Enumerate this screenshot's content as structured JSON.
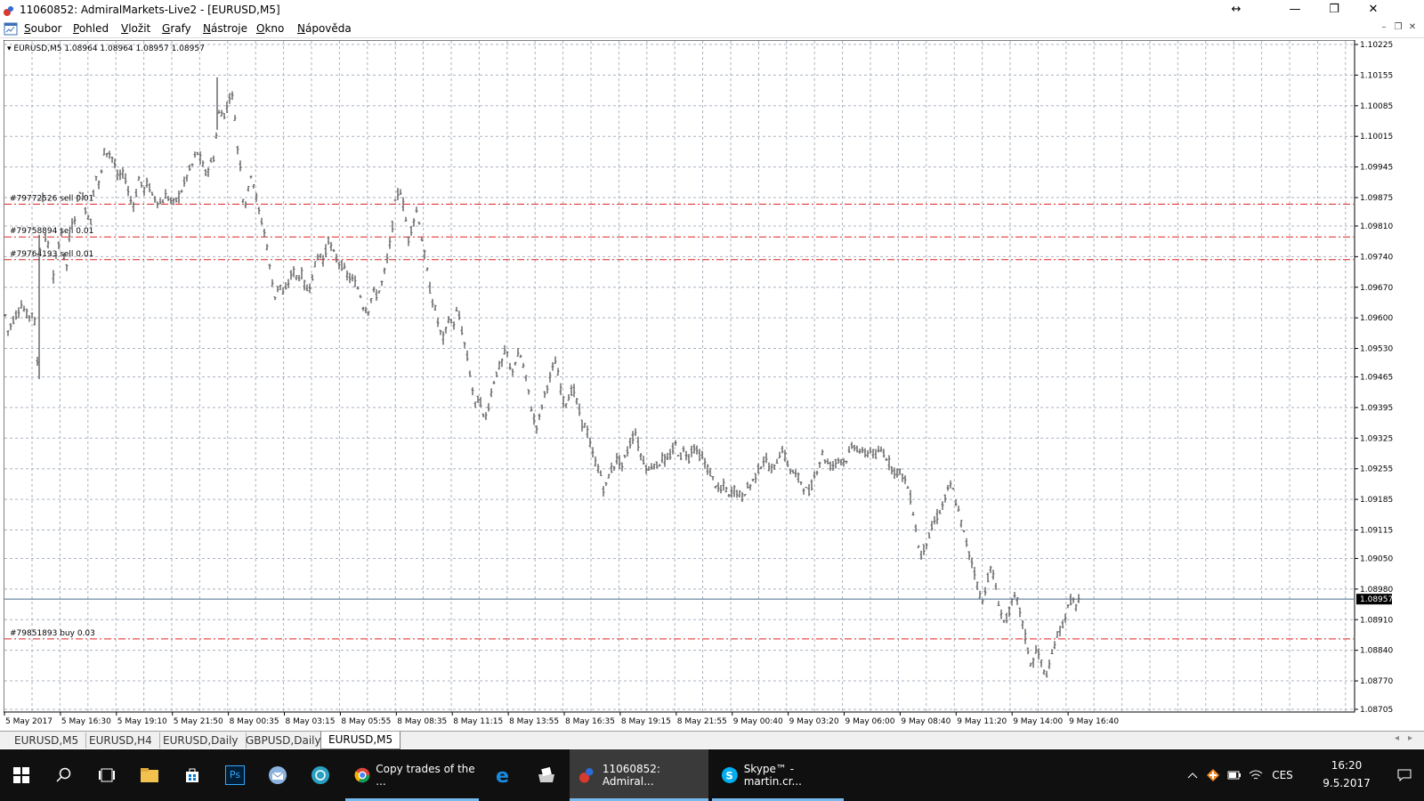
{
  "window": {
    "title": "11060852: AdmiralMarkets-Live2 - [EURUSD,M5]",
    "controls": {
      "resize_glyph": "↔",
      "minimize": "—",
      "maximize": "❐",
      "close": "✕"
    }
  },
  "menu": {
    "items": [
      "Soubor",
      "Pohled",
      "Vložit",
      "Grafy",
      "Nástroje",
      "Okno",
      "Nápověda"
    ],
    "mdi_controls": [
      "–",
      "❐",
      "✕"
    ]
  },
  "chart": {
    "header_label": "▾ EURUSD,M5  1.08964 1.08964 1.08957 1.08957",
    "current_price_label": "1.08957",
    "colors": {
      "candles": "#606060",
      "grid": "#a9b3c0",
      "order_line": "#e02020",
      "bid_line": "#4a6a8a"
    }
  },
  "chart_data": {
    "type": "candlestick",
    "symbol": "EURUSD",
    "timeframe": "M5",
    "ylim": [
      1.08705,
      1.10225
    ],
    "y_ticks": [
      "1.10225",
      "1.10155",
      "1.10085",
      "1.10015",
      "1.09945",
      "1.09875",
      "1.09810",
      "1.09740",
      "1.09670",
      "1.09600",
      "1.09530",
      "1.09465",
      "1.09395",
      "1.09325",
      "1.09255",
      "1.09185",
      "1.09115",
      "1.09050",
      "1.08980",
      "1.08910",
      "1.08840",
      "1.08770",
      "1.08705"
    ],
    "x_ticks": [
      "5 May 2017",
      "5 May 16:30",
      "5 May 19:10",
      "5 May 21:50",
      "8 May 00:35",
      "8 May 03:15",
      "8 May 05:55",
      "8 May 08:35",
      "8 May 11:15",
      "8 May 13:55",
      "8 May 16:35",
      "8 May 19:15",
      "8 May 21:55",
      "9 May 00:40",
      "9 May 03:20",
      "9 May 06:00",
      "9 May 08:40",
      "9 May 11:20",
      "9 May 14:00",
      "9 May 16:40"
    ],
    "price_path": [
      [
        0,
        1.0963
      ],
      [
        5,
        1.0957
      ],
      [
        12,
        1.096
      ],
      [
        20,
        1.0963
      ],
      [
        28,
        1.096
      ],
      [
        34,
        1.0962
      ],
      [
        38,
        1.095
      ],
      [
        40,
        1.0972
      ],
      [
        44,
        1.0988
      ],
      [
        48,
        1.0975
      ],
      [
        52,
        1.0978
      ],
      [
        55,
        1.0968
      ],
      [
        60,
        1.0975
      ],
      [
        65,
        1.098
      ],
      [
        70,
        1.097
      ],
      [
        75,
        1.098
      ],
      [
        80,
        1.0983
      ],
      [
        85,
        1.099
      ],
      [
        92,
        1.0985
      ],
      [
        98,
        1.0982
      ],
      [
        103,
        1.0993
      ],
      [
        108,
        1.099
      ],
      [
        113,
        1.0998
      ],
      [
        118,
        1.0998
      ],
      [
        124,
        1.0996
      ],
      [
        128,
        1.0992
      ],
      [
        133,
        1.0993
      ],
      [
        137,
        1.0992
      ],
      [
        142,
        1.0987
      ],
      [
        147,
        1.0986
      ],
      [
        152,
        1.0992
      ],
      [
        157,
        1.0989
      ],
      [
        162,
        1.0991
      ],
      [
        167,
        1.0988
      ],
      [
        172,
        1.0987
      ],
      [
        177,
        1.0986
      ],
      [
        182,
        1.0988
      ],
      [
        187,
        1.0987
      ],
      [
        192,
        1.0986
      ],
      [
        197,
        1.0988
      ],
      [
        202,
        1.099
      ],
      [
        207,
        1.0993
      ],
      [
        212,
        1.0995
      ],
      [
        217,
        1.0998
      ],
      [
        222,
        1.0996
      ],
      [
        227,
        1.0993
      ],
      [
        232,
        1.0995
      ],
      [
        237,
        1.0997
      ],
      [
        240,
        1.1004
      ],
      [
        243,
        1.1008
      ],
      [
        247,
        1.1006
      ],
      [
        251,
        1.1008
      ],
      [
        255,
        1.1012
      ],
      [
        259,
        1.1009
      ],
      [
        262,
        1.1
      ],
      [
        266,
        1.0995
      ],
      [
        270,
        1.0985
      ],
      [
        274,
        1.0988
      ],
      [
        278,
        1.0993
      ],
      [
        282,
        1.099
      ],
      [
        286,
        1.0985
      ],
      [
        290,
        1.0982
      ],
      [
        295,
        1.0978
      ],
      [
        300,
        1.097
      ],
      [
        305,
        1.0965
      ],
      [
        310,
        1.0968
      ],
      [
        315,
        1.0965
      ],
      [
        320,
        1.0968
      ],
      [
        325,
        1.0971
      ],
      [
        330,
        1.0969
      ],
      [
        335,
        1.097
      ],
      [
        340,
        1.0966
      ],
      [
        345,
        1.0968
      ],
      [
        350,
        1.0972
      ],
      [
        355,
        1.0975
      ],
      [
        360,
        1.0973
      ],
      [
        365,
        1.0978
      ],
      [
        370,
        1.0975
      ],
      [
        375,
        1.0973
      ],
      [
        380,
        1.0972
      ],
      [
        385,
        1.097
      ],
      [
        390,
        1.0969
      ],
      [
        395,
        1.0968
      ],
      [
        400,
        1.0966
      ],
      [
        405,
        1.0962
      ],
      [
        410,
        1.0962
      ],
      [
        415,
        1.0966
      ],
      [
        420,
        1.0965
      ],
      [
        425,
        1.0968
      ],
      [
        430,
        1.0972
      ],
      [
        435,
        1.0978
      ],
      [
        440,
        1.0986
      ],
      [
        445,
        1.099
      ],
      [
        450,
        1.0985
      ],
      [
        455,
        1.0978
      ],
      [
        460,
        1.0982
      ],
      [
        465,
        1.0985
      ],
      [
        470,
        1.0978
      ],
      [
        475,
        1.0972
      ],
      [
        480,
        1.0965
      ],
      [
        485,
        1.0962
      ],
      [
        490,
        1.0957
      ],
      [
        495,
        1.0955
      ],
      [
        500,
        1.096
      ],
      [
        505,
        1.0958
      ],
      [
        510,
        1.0962
      ],
      [
        515,
        1.0957
      ],
      [
        520,
        1.0952
      ],
      [
        525,
        1.0946
      ],
      [
        530,
        1.094
      ],
      [
        535,
        1.0942
      ],
      [
        540,
        1.0936
      ],
      [
        545,
        1.094
      ],
      [
        550,
        1.0945
      ],
      [
        555,
        1.0948
      ],
      [
        560,
        1.095
      ],
      [
        565,
        1.0953
      ],
      [
        570,
        1.0947
      ],
      [
        575,
        1.095
      ],
      [
        580,
        1.0952
      ],
      [
        585,
        1.0948
      ],
      [
        590,
        1.0943
      ],
      [
        595,
        1.0937
      ],
      [
        600,
        1.0935
      ],
      [
        605,
        1.094
      ],
      [
        610,
        1.0944
      ],
      [
        615,
        1.0947
      ],
      [
        620,
        1.095
      ],
      [
        625,
        1.0945
      ],
      [
        630,
        1.094
      ],
      [
        635,
        1.0942
      ],
      [
        640,
        1.0944
      ],
      [
        645,
        1.094
      ],
      [
        650,
        1.0936
      ],
      [
        655,
        1.0935
      ],
      [
        660,
        1.093
      ],
      [
        665,
        1.0927
      ],
      [
        670,
        1.0925
      ],
      [
        675,
        1.092
      ],
      [
        680,
        1.0924
      ],
      [
        685,
        1.0926
      ],
      [
        690,
        1.0928
      ],
      [
        695,
        1.0926
      ],
      [
        700,
        1.0929
      ],
      [
        705,
        1.0932
      ],
      [
        710,
        1.0934
      ],
      [
        715,
        1.0929
      ],
      [
        720,
        1.0927
      ],
      [
        725,
        1.0925
      ],
      [
        730,
        1.0927
      ],
      [
        735,
        1.0926
      ],
      [
        740,
        1.0928
      ],
      [
        745,
        1.0927
      ],
      [
        750,
        1.0929
      ],
      [
        755,
        1.0931
      ],
      [
        760,
        1.0928
      ],
      [
        765,
        1.093
      ],
      [
        770,
        1.0928
      ],
      [
        775,
        1.0931
      ],
      [
        780,
        1.0929
      ],
      [
        785,
        1.0928
      ],
      [
        790,
        1.0926
      ],
      [
        795,
        1.0924
      ],
      [
        800,
        1.0922
      ],
      [
        805,
        1.092
      ],
      [
        810,
        1.0922
      ],
      [
        815,
        1.0919
      ],
      [
        820,
        1.0921
      ],
      [
        825,
        1.092
      ],
      [
        830,
        1.0919
      ],
      [
        835,
        1.0921
      ],
      [
        840,
        1.0922
      ],
      [
        845,
        1.0924
      ],
      [
        850,
        1.0926
      ],
      [
        855,
        1.0928
      ],
      [
        860,
        1.0926
      ],
      [
        865,
        1.0925
      ],
      [
        870,
        1.0928
      ],
      [
        875,
        1.093
      ],
      [
        880,
        1.0927
      ],
      [
        885,
        1.0925
      ],
      [
        890,
        1.0924
      ],
      [
        895,
        1.0923
      ],
      [
        900,
        1.0921
      ],
      [
        905,
        1.092
      ],
      [
        910,
        1.0923
      ],
      [
        915,
        1.0926
      ],
      [
        920,
        1.0929
      ],
      [
        925,
        1.0927
      ],
      [
        930,
        1.0926
      ],
      [
        935,
        1.0927
      ],
      [
        940,
        1.0928
      ],
      [
        945,
        1.0927
      ],
      [
        950,
        1.0929
      ],
      [
        955,
        1.0931
      ],
      [
        960,
        1.093
      ],
      [
        965,
        1.0929
      ],
      [
        970,
        1.0929
      ],
      [
        975,
        1.093
      ],
      [
        980,
        1.0928
      ],
      [
        985,
        1.093
      ],
      [
        990,
        1.0929
      ],
      [
        995,
        1.0927
      ],
      [
        1000,
        1.0925
      ],
      [
        1005,
        1.0925
      ],
      [
        1010,
        1.0924
      ],
      [
        1015,
        1.0922
      ],
      [
        1020,
        1.0918
      ],
      [
        1025,
        1.0912
      ],
      [
        1030,
        1.0905
      ],
      [
        1035,
        1.0908
      ],
      [
        1040,
        1.091
      ],
      [
        1045,
        1.0913
      ],
      [
        1050,
        1.0915
      ],
      [
        1055,
        1.0917
      ],
      [
        1060,
        1.092
      ],
      [
        1065,
        1.0922
      ],
      [
        1070,
        1.0918
      ],
      [
        1075,
        1.0914
      ],
      [
        1080,
        1.091
      ],
      [
        1085,
        1.0906
      ],
      [
        1090,
        1.0903
      ],
      [
        1095,
        1.0898
      ],
      [
        1100,
        1.0895
      ],
      [
        1105,
        1.09
      ],
      [
        1110,
        1.0903
      ],
      [
        1115,
        1.0898
      ],
      [
        1120,
        1.0893
      ],
      [
        1125,
        1.089
      ],
      [
        1130,
        1.0893
      ],
      [
        1135,
        1.0896
      ],
      [
        1140,
        1.0895
      ],
      [
        1145,
        1.089
      ],
      [
        1150,
        1.0885
      ],
      [
        1155,
        1.088
      ],
      [
        1160,
        1.0884
      ],
      [
        1165,
        1.0882
      ],
      [
        1170,
        1.0878
      ],
      [
        1175,
        1.088
      ],
      [
        1180,
        1.0885
      ],
      [
        1185,
        1.0888
      ],
      [
        1190,
        1.089
      ],
      [
        1195,
        1.0893
      ],
      [
        1200,
        1.0896
      ],
      [
        1205,
        1.0894
      ],
      [
        1210,
        1.0896
      ]
    ],
    "order_lines": [
      {
        "label": "#79772526 sell 0.01",
        "price": 1.0986
      },
      {
        "label": "#79758894 sell 0.01",
        "price": 1.09785
      },
      {
        "label": "#79764193 sell 0.01",
        "price": 1.09733
      },
      {
        "label": "#79851893 buy 0.03",
        "price": 1.08866
      }
    ],
    "bid_price": 1.08957
  },
  "tabs": [
    {
      "label": "EURUSD,M5",
      "active": false
    },
    {
      "label": "EURUSD,H4",
      "active": false
    },
    {
      "label": "EURUSD,Daily",
      "active": false
    },
    {
      "label": "GBPUSD,Daily",
      "active": false
    },
    {
      "label": "EURUSD,M5",
      "active": true
    }
  ],
  "tab_scroll": {
    "left": "◂",
    "right": "▸"
  },
  "taskbar": {
    "apps": [
      {
        "label": "Copy trades of the ...",
        "icon": "chrome-icon"
      },
      {
        "label": "11060852: Admiral...",
        "icon": "metatrader-icon",
        "active": true
      },
      {
        "label": "Skype™ - martin.cr...",
        "icon": "skype-icon"
      }
    ],
    "tray": {
      "language": "CES",
      "time": "16:20",
      "date": "9.5.2017"
    },
    "ps_label": "Ps"
  }
}
